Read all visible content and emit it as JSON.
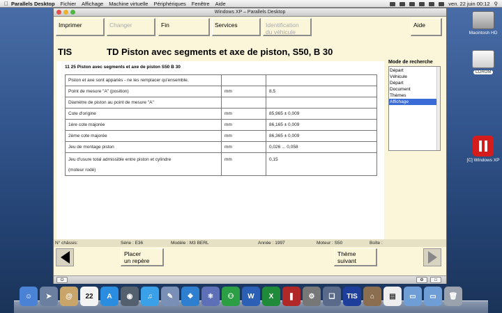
{
  "mac_menubar": {
    "app_name": "Parallels Desktop",
    "menus": [
      "Fichier",
      "Affichage",
      "Machine virtuelle",
      "Périphériques",
      "Fenêtre",
      "Aide"
    ],
    "clock": "ven. 22 juin  00:12"
  },
  "vm_window": {
    "title": "Windows XP – Parallels Desktop"
  },
  "toolbar": {
    "imprimer": "Imprimer",
    "changer": "Changer",
    "fin": "Fin",
    "services": "Services",
    "identification_1": "Identification",
    "identification_2": "du véhicule",
    "aide": "Aide"
  },
  "header": {
    "app": "TIS",
    "doc_title": "TD  Piston avec segments et axe de piston, S50, B 30"
  },
  "content": {
    "subtitle": "11 25 Piston avec segments et axe de piston S50  B 30",
    "rows": [
      {
        "desc": "Piston et axe sont appariés - ne les remplacer qu'ensemble.",
        "unit": "",
        "value": ""
      },
      {
        "desc": "Point de mesure \"A\" (position)",
        "unit": "mm",
        "value": "8,5"
      },
      {
        "desc": "Diamètre de piston au point de mesure \"A\"",
        "unit": "",
        "value": ""
      },
      {
        "desc": "Cote d'origine",
        "unit": "mm",
        "value": "85,965 ± 0,009"
      },
      {
        "desc": "1ère cote majorée",
        "unit": "mm",
        "value": "86,165 ± 0,009"
      },
      {
        "desc": "2ème cote majorée",
        "unit": "mm",
        "value": "86,365 ± 0,009"
      },
      {
        "desc": "Jeu de montage piston",
        "unit": "mm",
        "value": "0,026 ... 0,058"
      },
      {
        "desc": "Jeu d'usure total admissible entre piston et cylindre",
        "desc2": "(moteur rodé)",
        "unit": "mm",
        "value": "0,15"
      }
    ]
  },
  "search": {
    "label": "Mode de recherche",
    "items": [
      "Départ",
      "Véhicule",
      "Départ",
      "Document",
      "Thèmes",
      "Affichage"
    ],
    "selected_index": 5
  },
  "status": {
    "chassis": "N° châssis:",
    "serie": "Série : E36",
    "modele": "Modèle : M3 BERL",
    "annee": "Année : 1997",
    "moteur": "Moteur : S50",
    "boite": "Boîte :"
  },
  "nav": {
    "placer_1": "Placer",
    "placer_2": "un repère",
    "theme_1": "Thème",
    "theme_2": "suivant"
  },
  "desktop_icons": {
    "hd": "Macintosh HD",
    "cdrom": "CDROM",
    "parallels": "[C] Windows XP"
  },
  "dock": {
    "tis_label": "TIS",
    "calendar_day": "22"
  }
}
